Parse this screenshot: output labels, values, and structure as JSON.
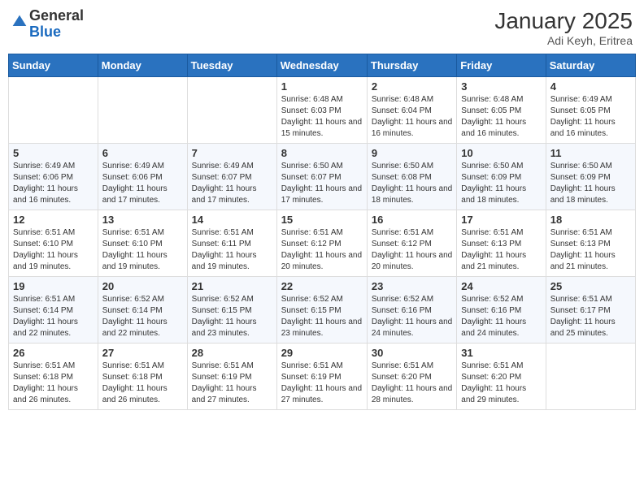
{
  "header": {
    "logo_general": "General",
    "logo_blue": "Blue",
    "month_year": "January 2025",
    "location": "Adi Keyh, Eritrea"
  },
  "weekdays": [
    "Sunday",
    "Monday",
    "Tuesday",
    "Wednesday",
    "Thursday",
    "Friday",
    "Saturday"
  ],
  "weeks": [
    [
      {
        "day": "",
        "text": ""
      },
      {
        "day": "",
        "text": ""
      },
      {
        "day": "",
        "text": ""
      },
      {
        "day": "1",
        "text": "Sunrise: 6:48 AM\nSunset: 6:03 PM\nDaylight: 11 hours and 15 minutes."
      },
      {
        "day": "2",
        "text": "Sunrise: 6:48 AM\nSunset: 6:04 PM\nDaylight: 11 hours and 16 minutes."
      },
      {
        "day": "3",
        "text": "Sunrise: 6:48 AM\nSunset: 6:05 PM\nDaylight: 11 hours and 16 minutes."
      },
      {
        "day": "4",
        "text": "Sunrise: 6:49 AM\nSunset: 6:05 PM\nDaylight: 11 hours and 16 minutes."
      }
    ],
    [
      {
        "day": "5",
        "text": "Sunrise: 6:49 AM\nSunset: 6:06 PM\nDaylight: 11 hours and 16 minutes."
      },
      {
        "day": "6",
        "text": "Sunrise: 6:49 AM\nSunset: 6:06 PM\nDaylight: 11 hours and 17 minutes."
      },
      {
        "day": "7",
        "text": "Sunrise: 6:49 AM\nSunset: 6:07 PM\nDaylight: 11 hours and 17 minutes."
      },
      {
        "day": "8",
        "text": "Sunrise: 6:50 AM\nSunset: 6:07 PM\nDaylight: 11 hours and 17 minutes."
      },
      {
        "day": "9",
        "text": "Sunrise: 6:50 AM\nSunset: 6:08 PM\nDaylight: 11 hours and 18 minutes."
      },
      {
        "day": "10",
        "text": "Sunrise: 6:50 AM\nSunset: 6:09 PM\nDaylight: 11 hours and 18 minutes."
      },
      {
        "day": "11",
        "text": "Sunrise: 6:50 AM\nSunset: 6:09 PM\nDaylight: 11 hours and 18 minutes."
      }
    ],
    [
      {
        "day": "12",
        "text": "Sunrise: 6:51 AM\nSunset: 6:10 PM\nDaylight: 11 hours and 19 minutes."
      },
      {
        "day": "13",
        "text": "Sunrise: 6:51 AM\nSunset: 6:10 PM\nDaylight: 11 hours and 19 minutes."
      },
      {
        "day": "14",
        "text": "Sunrise: 6:51 AM\nSunset: 6:11 PM\nDaylight: 11 hours and 19 minutes."
      },
      {
        "day": "15",
        "text": "Sunrise: 6:51 AM\nSunset: 6:12 PM\nDaylight: 11 hours and 20 minutes."
      },
      {
        "day": "16",
        "text": "Sunrise: 6:51 AM\nSunset: 6:12 PM\nDaylight: 11 hours and 20 minutes."
      },
      {
        "day": "17",
        "text": "Sunrise: 6:51 AM\nSunset: 6:13 PM\nDaylight: 11 hours and 21 minutes."
      },
      {
        "day": "18",
        "text": "Sunrise: 6:51 AM\nSunset: 6:13 PM\nDaylight: 11 hours and 21 minutes."
      }
    ],
    [
      {
        "day": "19",
        "text": "Sunrise: 6:51 AM\nSunset: 6:14 PM\nDaylight: 11 hours and 22 minutes."
      },
      {
        "day": "20",
        "text": "Sunrise: 6:52 AM\nSunset: 6:14 PM\nDaylight: 11 hours and 22 minutes."
      },
      {
        "day": "21",
        "text": "Sunrise: 6:52 AM\nSunset: 6:15 PM\nDaylight: 11 hours and 23 minutes."
      },
      {
        "day": "22",
        "text": "Sunrise: 6:52 AM\nSunset: 6:15 PM\nDaylight: 11 hours and 23 minutes."
      },
      {
        "day": "23",
        "text": "Sunrise: 6:52 AM\nSunset: 6:16 PM\nDaylight: 11 hours and 24 minutes."
      },
      {
        "day": "24",
        "text": "Sunrise: 6:52 AM\nSunset: 6:16 PM\nDaylight: 11 hours and 24 minutes."
      },
      {
        "day": "25",
        "text": "Sunrise: 6:51 AM\nSunset: 6:17 PM\nDaylight: 11 hours and 25 minutes."
      }
    ],
    [
      {
        "day": "26",
        "text": "Sunrise: 6:51 AM\nSunset: 6:18 PM\nDaylight: 11 hours and 26 minutes."
      },
      {
        "day": "27",
        "text": "Sunrise: 6:51 AM\nSunset: 6:18 PM\nDaylight: 11 hours and 26 minutes."
      },
      {
        "day": "28",
        "text": "Sunrise: 6:51 AM\nSunset: 6:19 PM\nDaylight: 11 hours and 27 minutes."
      },
      {
        "day": "29",
        "text": "Sunrise: 6:51 AM\nSunset: 6:19 PM\nDaylight: 11 hours and 27 minutes."
      },
      {
        "day": "30",
        "text": "Sunrise: 6:51 AM\nSunset: 6:20 PM\nDaylight: 11 hours and 28 minutes."
      },
      {
        "day": "31",
        "text": "Sunrise: 6:51 AM\nSunset: 6:20 PM\nDaylight: 11 hours and 29 minutes."
      },
      {
        "day": "",
        "text": ""
      }
    ]
  ]
}
